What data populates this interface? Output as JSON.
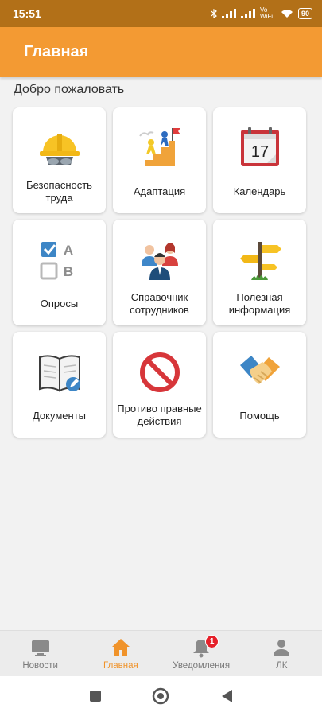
{
  "status": {
    "time": "15:51",
    "network": "Vo WiFi",
    "battery": "90"
  },
  "appbar": {
    "title": "Главная"
  },
  "welcome": "Добро пожаловать",
  "tiles": [
    {
      "label": "Безопасность труда",
      "icon": "hard-hat-icon"
    },
    {
      "label": "Адаптация",
      "icon": "climb-stairs-icon"
    },
    {
      "label": "Календарь",
      "icon": "calendar-icon",
      "date": "17"
    },
    {
      "label": "Опросы",
      "icon": "survey-checkbox-icon",
      "opt_a": "A",
      "opt_b": "B"
    },
    {
      "label": "Справочник сотрудников",
      "icon": "employees-icon"
    },
    {
      "label": "Полезная информация",
      "icon": "signpost-icon"
    },
    {
      "label": "Документы",
      "icon": "document-book-icon"
    },
    {
      "label": "Противо правные действия",
      "icon": "prohibited-icon"
    },
    {
      "label": "Помощь",
      "icon": "handshake-icon"
    }
  ],
  "nav": [
    {
      "label": "Новости",
      "icon": "news-icon",
      "active": false
    },
    {
      "label": "Главная",
      "icon": "home-icon",
      "active": true
    },
    {
      "label": "Уведомления",
      "icon": "bell-icon",
      "active": false,
      "badge": "1"
    },
    {
      "label": "ЛК",
      "icon": "profile-icon",
      "active": false
    }
  ],
  "colors": {
    "accent": "#f39a33",
    "statusbar": "#b27018",
    "active_nav": "#f0932a",
    "badge": "#e5202a"
  }
}
